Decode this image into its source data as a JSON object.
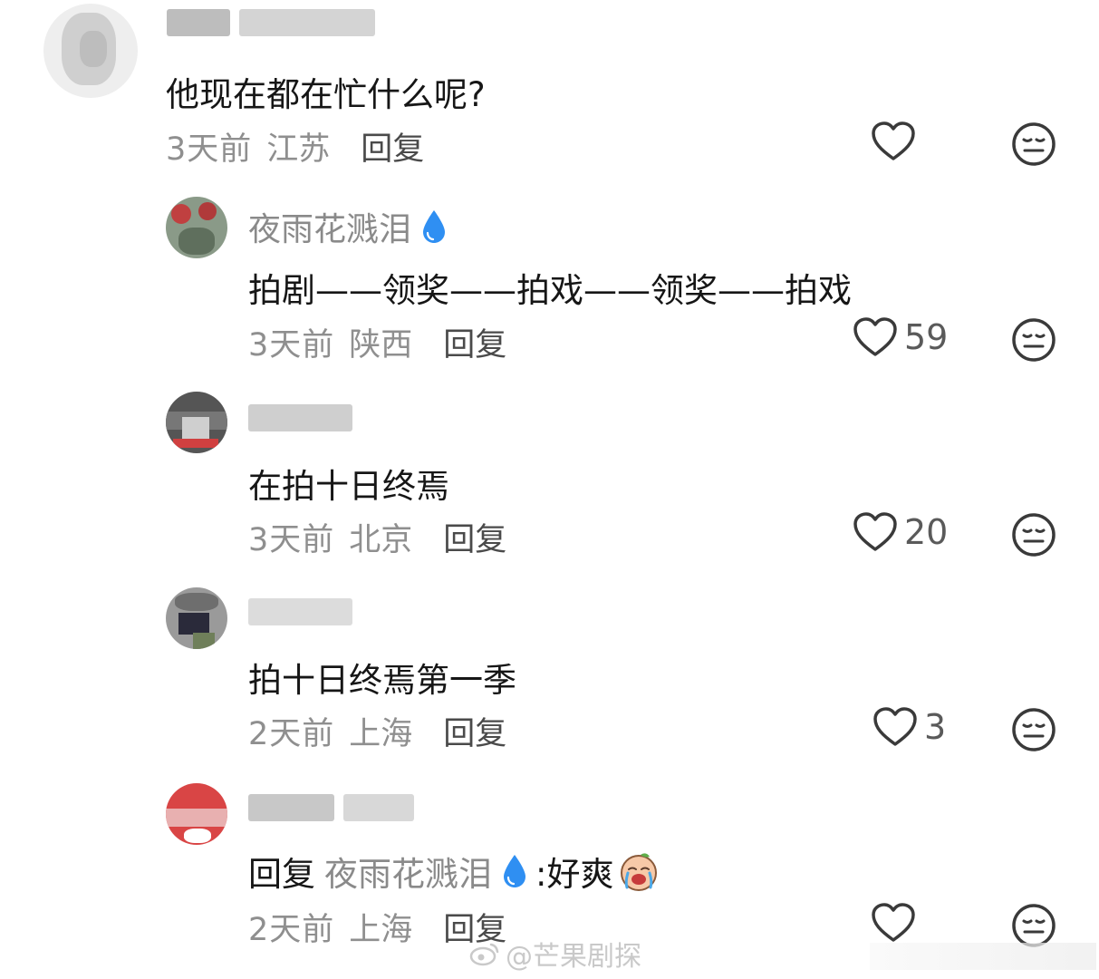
{
  "comments": [
    {
      "name": "",
      "text": "他现在都在忙什么呢?",
      "time": "3天前",
      "location": "江苏",
      "reply_label": "回复",
      "likes": ""
    },
    {
      "name": "夜雨花溅泪",
      "text": "拍剧——领奖——拍戏——领奖——拍戏",
      "time": "3天前",
      "location": "陕西",
      "reply_label": "回复",
      "likes": "59"
    },
    {
      "name": "",
      "text": "在拍十日终焉",
      "time": "3天前",
      "location": "北京",
      "reply_label": "回复",
      "likes": "20"
    },
    {
      "name": "",
      "text": "拍十日终焉第一季",
      "time": "2天前",
      "location": "上海",
      "reply_label": "回复",
      "likes": "3"
    },
    {
      "name": "",
      "reply_prefix": "回复",
      "reply_to": "夜雨花溅泪",
      "text": ":好爽",
      "time": "2天前",
      "location": "上海",
      "reply_label": "回复",
      "likes": ""
    }
  ],
  "watermark": "@芒果剧探",
  "icons": {
    "like": "heart-outline-icon",
    "dislike": "neutral-face-icon",
    "name_badge": "water-drop-icon"
  },
  "colors": {
    "text": "#161616",
    "meta": "#8f8f8f",
    "name": "#8a8a8a",
    "drop": "#2f8ff2"
  }
}
